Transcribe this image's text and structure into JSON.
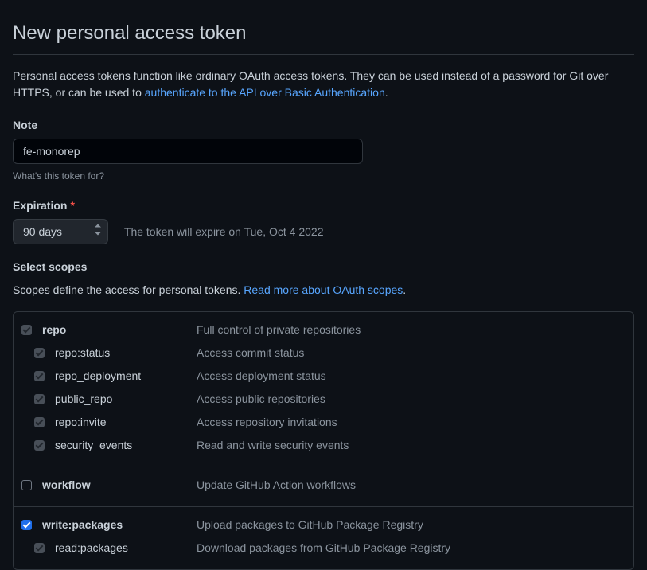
{
  "title": "New personal access token",
  "description_text": "Personal access tokens function like ordinary OAuth access tokens. They can be used instead of a password for Git over HTTPS, or can be used to ",
  "description_link": "authenticate to the API over Basic Authentication",
  "description_period": ".",
  "note": {
    "label": "Note",
    "value": "fe-monorep",
    "hint": "What's this token for?"
  },
  "expiration": {
    "label": "Expiration",
    "selected": "90 days",
    "note": "The token will expire on Tue, Oct 4 2022"
  },
  "scopes": {
    "heading": "Select scopes",
    "description_text": "Scopes define the access for personal tokens. ",
    "description_link": "Read more about OAuth scopes",
    "description_period": ".",
    "groups": [
      {
        "name": "repo",
        "desc": "Full control of private repositories",
        "checked": true,
        "disabled": true,
        "children": [
          {
            "name": "repo:status",
            "desc": "Access commit status",
            "checked": true,
            "disabled": true
          },
          {
            "name": "repo_deployment",
            "desc": "Access deployment status",
            "checked": true,
            "disabled": true
          },
          {
            "name": "public_repo",
            "desc": "Access public repositories",
            "checked": true,
            "disabled": true
          },
          {
            "name": "repo:invite",
            "desc": "Access repository invitations",
            "checked": true,
            "disabled": true
          },
          {
            "name": "security_events",
            "desc": "Read and write security events",
            "checked": true,
            "disabled": true
          }
        ]
      },
      {
        "name": "workflow",
        "desc": "Update GitHub Action workflows",
        "checked": false,
        "disabled": false,
        "children": []
      },
      {
        "name": "write:packages",
        "desc": "Upload packages to GitHub Package Registry",
        "checked": true,
        "disabled": false,
        "children": [
          {
            "name": "read:packages",
            "desc": "Download packages from GitHub Package Registry",
            "checked": true,
            "disabled": true
          }
        ]
      }
    ]
  }
}
